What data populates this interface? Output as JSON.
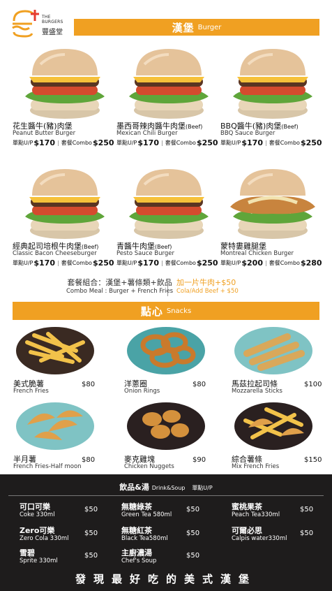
{
  "logo": {
    "en_line1": "THE",
    "en_line2": "BURGERS",
    "cn": "豐盛堂"
  },
  "burger_section": {
    "cn": "漢堡",
    "en": "Burger"
  },
  "burgers": [
    {
      "cn": "花生醬牛(豬)肉堡",
      "beef": "",
      "en": "Peanut Butter Burger",
      "single_label": "單點U/P",
      "single_price": "$170",
      "combo_label": "套餐Combo",
      "combo_price": "$250"
    },
    {
      "cn": "墨西哥辣肉醬牛肉堡",
      "beef": "(Beef)",
      "en": "Mexican Chili Burger",
      "single_label": "單點U/P",
      "single_price": "$170",
      "combo_label": "套餐Combo",
      "combo_price": "$250"
    },
    {
      "cn": "BBQ醬牛(豬)肉堡",
      "beef": "(Beef)",
      "en": "BBQ Sauce Burger",
      "single_label": "單點U/P",
      "single_price": "$170",
      "combo_label": "套餐Combo",
      "combo_price": "$250"
    },
    {
      "cn": "經典起司培根牛肉堡",
      "beef": "(Beef)",
      "en": "Classic Bacon Cheeseburger",
      "single_label": "單點U/P",
      "single_price": "$170",
      "combo_label": "套餐Combo",
      "combo_price": "$250"
    },
    {
      "cn": "青醬牛肉堡",
      "beef": "(Beef)",
      "en": "Pesto Sauce  Burger",
      "single_label": "單點U/P",
      "single_price": "$170",
      "combo_label": "套餐Combo",
      "combo_price": "$250"
    },
    {
      "cn": "蒙特婁雞腿堡",
      "beef": "",
      "en": "Montreal Chicken Burger",
      "single_label": "單點U/P",
      "single_price": "$200",
      "combo_label": "套餐Combo",
      "combo_price": "$280"
    }
  ],
  "combo": {
    "cn": "套餐組合：漢堡+薯條類+飲品",
    "en": "Combo Meal : Burger + French Fries",
    "add_cn": "加一片牛肉+$50",
    "add_en": "Cola/Add Beef + $50"
  },
  "snack_section": {
    "cn": "點心",
    "en": "Snacks"
  },
  "snacks": [
    {
      "cn": "美式脆薯",
      "en": "French Fries",
      "price": "$80"
    },
    {
      "cn": "洋蔥圈",
      "en": "Onion Rings",
      "price": "$80"
    },
    {
      "cn": "馬茲拉起司條",
      "en": "Mozzarella Sticks",
      "price": "$100"
    },
    {
      "cn": "半月薯",
      "en": "French Fries-Half moon",
      "price": "$80"
    },
    {
      "cn": "麥克雞塊",
      "en": "Chicken Nuggets",
      "price": "$90"
    },
    {
      "cn": "綜合薯條",
      "en": "Mix French Fries",
      "price": "$150"
    }
  ],
  "drinks_section": {
    "cn": "飲品&湯",
    "en": "Drink&Soup",
    "unit": "單點U/P"
  },
  "drinks": [
    {
      "cn": "可口可樂",
      "en": "Coke 330ml",
      "price": "$50"
    },
    {
      "cn": "無糖綠茶",
      "en": "Green Tea 580ml",
      "price": "$50"
    },
    {
      "cn": "蜜桃果茶",
      "en": "Peach Tea330ml",
      "price": "$50"
    },
    {
      "cn": "Zero可樂",
      "en": "Zero Cola 330ml",
      "price": "$50"
    },
    {
      "cn": "無糖紅茶",
      "en": "Black Tea580ml",
      "price": "$50"
    },
    {
      "cn": "可爾必思",
      "en": "Calpis water330ml",
      "price": "$50"
    },
    {
      "cn": "雪碧",
      "en": "Sprite 330ml",
      "price": "$50"
    },
    {
      "cn": "主廚濃湯",
      "en": "Chef's Soup",
      "price": "$50"
    }
  ],
  "slogan": "發現最好吃的美式漢堡",
  "colors": {
    "accent": "#f0a022",
    "dark": "#1e1c1c",
    "logo_red": "#e53b2f"
  }
}
